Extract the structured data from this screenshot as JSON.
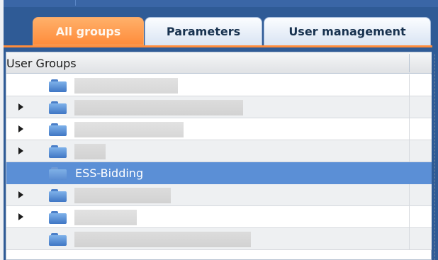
{
  "tabs": [
    {
      "label": "All groups",
      "active": true
    },
    {
      "label": "Parameters",
      "active": false
    },
    {
      "label": "User management",
      "active": false
    }
  ],
  "table": {
    "header": "User Groups",
    "rows": [
      {
        "label": "",
        "expander": false,
        "selected": false
      },
      {
        "label": "",
        "expander": true,
        "selected": false
      },
      {
        "label": "",
        "expander": true,
        "selected": false
      },
      {
        "label": "",
        "expander": true,
        "selected": false
      },
      {
        "label": "ESS-Bidding",
        "expander": false,
        "selected": true
      },
      {
        "label": "",
        "expander": true,
        "selected": false
      },
      {
        "label": "",
        "expander": true,
        "selected": false
      },
      {
        "label": "",
        "expander": false,
        "selected": false
      }
    ]
  },
  "colors": {
    "accent_tab": "#ff8c3b",
    "selection": "#5b8fd6",
    "frame": "#2f5b96"
  },
  "icons": {
    "folder": "folder-icon",
    "expander": "expand-arrow-icon"
  }
}
